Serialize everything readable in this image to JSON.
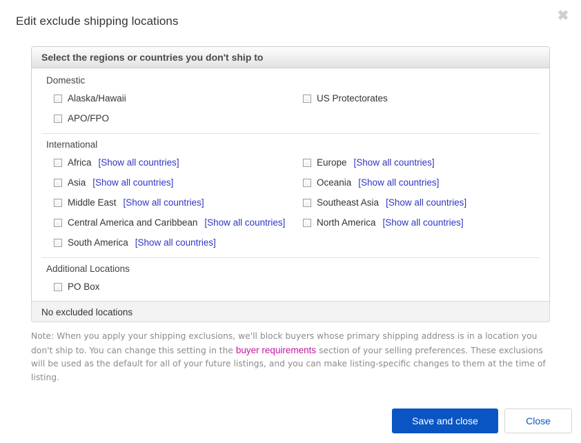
{
  "dialog": {
    "title": "Edit exclude shipping locations",
    "close_icon": "close-icon",
    "close_glyph": "✖"
  },
  "panel": {
    "header": "Select the regions or countries you don't ship to",
    "groups": [
      {
        "title": "Domestic",
        "rows": [
          {
            "label": "Alaska/Hawaii",
            "link": "",
            "checked": false
          },
          {
            "label": "US Protectorates",
            "link": "",
            "checked": false
          },
          {
            "label": "APO/FPO",
            "link": "",
            "checked": false
          }
        ]
      },
      {
        "title": "International",
        "rows": [
          {
            "label": "Africa",
            "link": "[Show all countries]",
            "checked": false
          },
          {
            "label": "Europe",
            "link": "[Show all countries]",
            "checked": false
          },
          {
            "label": "Asia",
            "link": "[Show all countries]",
            "checked": false
          },
          {
            "label": "Oceania",
            "link": "[Show all countries]",
            "checked": false
          },
          {
            "label": "Middle East",
            "link": "[Show all countries]",
            "checked": false
          },
          {
            "label": "Southeast Asia",
            "link": "[Show all countries]",
            "checked": false
          },
          {
            "label": "Central America and Caribbean",
            "link": "[Show all countries]",
            "checked": false
          },
          {
            "label": "North America",
            "link": "[Show all countries]",
            "checked": false
          },
          {
            "label": "South America",
            "link": "[Show all countries]",
            "checked": false
          }
        ]
      },
      {
        "title": "Additional Locations",
        "rows": [
          {
            "label": "PO Box",
            "link": "",
            "checked": false
          }
        ]
      }
    ]
  },
  "excluded": {
    "status": "No excluded locations"
  },
  "note": {
    "part1": "Note: When you apply your shipping exclusions, we'll block buyers whose primary shipping address is in a location you don't ship to. You can change this setting in the ",
    "link": "buyer requirements",
    "part2": " section of your selling preferences. These exclusions will be used as the default for all of your future listings, and you can make listing-specific changes to them at the time of listing."
  },
  "footer": {
    "save_label": "Save and close",
    "close_label": "Close"
  },
  "colors": {
    "primary_button": "#0a55c4",
    "link_blue": "#2f36c4",
    "link_magenta": "#c4169c"
  }
}
